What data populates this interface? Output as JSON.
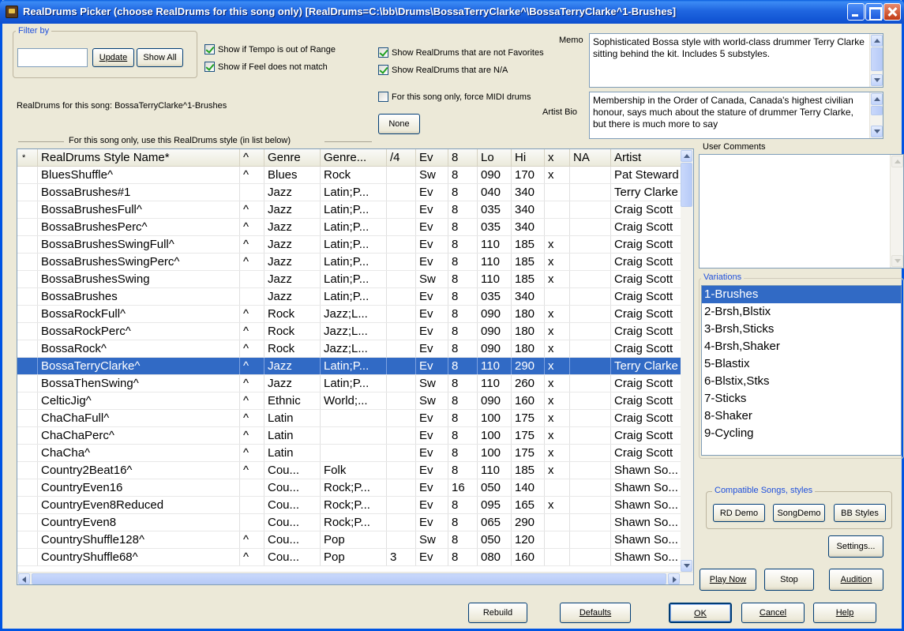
{
  "window": {
    "title": "RealDrums Picker (choose RealDrums for this song only)  [RealDrums=C:\\bb\\Drums\\BossaTerryClarke^\\BossaTerryClarke^1-Brushes]"
  },
  "filter": {
    "group_label": "Filter by",
    "input_value": "",
    "update_label": "Update",
    "show_all_label": "Show All"
  },
  "checks": {
    "tempo_out_of_range": "Show if Tempo is out of Range",
    "feel_mismatch": "Show if Feel does not match",
    "not_favorites": "Show RealDrums that are not Favorites",
    "na": "Show RealDrums that are N/A",
    "force_midi": "For this song only, force MIDI drums"
  },
  "song_info": "RealDrums for this song: BossaTerryClarke^1-Brushes",
  "none_label": "None",
  "list_caption": "For this song only, use this RealDrums style (in list below)",
  "memo": {
    "label": "Memo",
    "text": "Sophisticated Bossa style with world-class drummer Terry Clarke sitting behind the kit.  Includes 5 substyles."
  },
  "artist_bio": {
    "label": "Artist Bio",
    "text": "Membership in the Order of Canada, Canada's highest civilian honour, says much about the stature of drummer Terry Clarke, but there is much more to say"
  },
  "user_comments": {
    "label": "User Comments",
    "text": ""
  },
  "grid": {
    "headers": [
      "*",
      "RealDrums Style Name*",
      "^",
      "Genre",
      "Genre...",
      "/4",
      "Ev",
      "8",
      "Lo",
      "Hi",
      "x",
      "NA",
      "Artist"
    ],
    "rows": [
      [
        "",
        "BluesShuffle^",
        "^",
        "Blues",
        "Rock",
        "",
        "Sw",
        "8",
        "090",
        "170",
        "x",
        "",
        "Pat Steward"
      ],
      [
        "",
        "BossaBrushes#1",
        "",
        "Jazz",
        "Latin;P...",
        "",
        "Ev",
        "8",
        "040",
        "340",
        "",
        "",
        "Terry Clarke"
      ],
      [
        "",
        "BossaBrushesFull^",
        "^",
        "Jazz",
        "Latin;P...",
        "",
        "Ev",
        "8",
        "035",
        "340",
        "",
        "",
        "Craig Scott"
      ],
      [
        "",
        "BossaBrushesPerc^",
        "^",
        "Jazz",
        "Latin;P...",
        "",
        "Ev",
        "8",
        "035",
        "340",
        "",
        "",
        "Craig Scott"
      ],
      [
        "",
        "BossaBrushesSwingFull^",
        "^",
        "Jazz",
        "Latin;P...",
        "",
        "Ev",
        "8",
        "110",
        "185",
        "x",
        "",
        "Craig Scott"
      ],
      [
        "",
        "BossaBrushesSwingPerc^",
        "^",
        "Jazz",
        "Latin;P...",
        "",
        "Ev",
        "8",
        "110",
        "185",
        "x",
        "",
        "Craig Scott"
      ],
      [
        "",
        "BossaBrushesSwing",
        "",
        "Jazz",
        "Latin;P...",
        "",
        "Sw",
        "8",
        "110",
        "185",
        "x",
        "",
        "Craig Scott"
      ],
      [
        "",
        "BossaBrushes",
        "",
        "Jazz",
        "Latin;P...",
        "",
        "Ev",
        "8",
        "035",
        "340",
        "",
        "",
        "Craig Scott"
      ],
      [
        "",
        "BossaRockFull^",
        "^",
        "Rock",
        "Jazz;L...",
        "",
        "Ev",
        "8",
        "090",
        "180",
        "x",
        "",
        "Craig Scott"
      ],
      [
        "",
        "BossaRockPerc^",
        "^",
        "Rock",
        "Jazz;L...",
        "",
        "Ev",
        "8",
        "090",
        "180",
        "x",
        "",
        "Craig Scott"
      ],
      [
        "",
        "BossaRock^",
        "^",
        "Rock",
        "Jazz;L...",
        "",
        "Ev",
        "8",
        "090",
        "180",
        "x",
        "",
        "Craig Scott"
      ],
      [
        "",
        "BossaTerryClarke^",
        "^",
        "Jazz",
        "Latin;P...",
        "",
        "Ev",
        "8",
        "110",
        "290",
        "x",
        "",
        "Terry Clarke"
      ],
      [
        "",
        "BossaThenSwing^",
        "^",
        "Jazz",
        "Latin;P...",
        "",
        "Sw",
        "8",
        "110",
        "260",
        "x",
        "",
        "Craig Scott"
      ],
      [
        "",
        "CelticJig^",
        "^",
        "Ethnic",
        "World;...",
        "",
        "Sw",
        "8",
        "090",
        "160",
        "x",
        "",
        "Craig Scott"
      ],
      [
        "",
        "ChaChaFull^",
        "^",
        "Latin",
        "",
        "",
        "Ev",
        "8",
        "100",
        "175",
        "x",
        "",
        "Craig Scott"
      ],
      [
        "",
        "ChaChaPerc^",
        "^",
        "Latin",
        "",
        "",
        "Ev",
        "8",
        "100",
        "175",
        "x",
        "",
        "Craig Scott"
      ],
      [
        "",
        "ChaCha^",
        "^",
        "Latin",
        "",
        "",
        "Ev",
        "8",
        "100",
        "175",
        "x",
        "",
        "Craig Scott"
      ],
      [
        "",
        "Country2Beat16^",
        "^",
        "Cou...",
        "Folk",
        "",
        "Ev",
        "8",
        "110",
        "185",
        "x",
        "",
        "Shawn So..."
      ],
      [
        "",
        "CountryEven16",
        "",
        "Cou...",
        "Rock;P...",
        "",
        "Ev",
        "16",
        "050",
        "140",
        "",
        "",
        "Shawn So..."
      ],
      [
        "",
        "CountryEven8Reduced",
        "",
        "Cou...",
        "Rock;P...",
        "",
        "Ev",
        "8",
        "095",
        "165",
        "x",
        "",
        "Shawn So..."
      ],
      [
        "",
        "CountryEven8",
        "",
        "Cou...",
        "Rock;P...",
        "",
        "Ev",
        "8",
        "065",
        "290",
        "",
        "",
        "Shawn So..."
      ],
      [
        "",
        "CountryShuffle128^",
        "^",
        "Cou...",
        "Pop",
        "",
        "Sw",
        "8",
        "050",
        "120",
        "",
        "",
        "Shawn So..."
      ],
      [
        "",
        "CountryShuffle68^",
        "^",
        "Cou...",
        "Pop",
        "3",
        "Ev",
        "8",
        "080",
        "160",
        "",
        "",
        "Shawn So..."
      ]
    ],
    "selected_index": 11
  },
  "variations": {
    "label": "Variations",
    "items": [
      "1-Brushes",
      "2-Brsh,Blstix",
      "3-Brsh,Sticks",
      "4-Brsh,Shaker",
      "5-Blastix",
      "6-Blstix,Stks",
      "7-Sticks",
      "8-Shaker",
      "9-Cycling"
    ],
    "selected_index": 0
  },
  "compatible": {
    "label": "Compatible Songs, styles",
    "rd_demo": "RD Demo",
    "song_demo": "SongDemo",
    "bb_styles": "BB Styles"
  },
  "buttons": {
    "settings": "Settings...",
    "play_now": "Play Now",
    "stop": "Stop",
    "audition": "Audition",
    "rebuild": "Rebuild",
    "defaults": "Defaults",
    "ok": "OK",
    "cancel": "Cancel",
    "help": "Help"
  }
}
